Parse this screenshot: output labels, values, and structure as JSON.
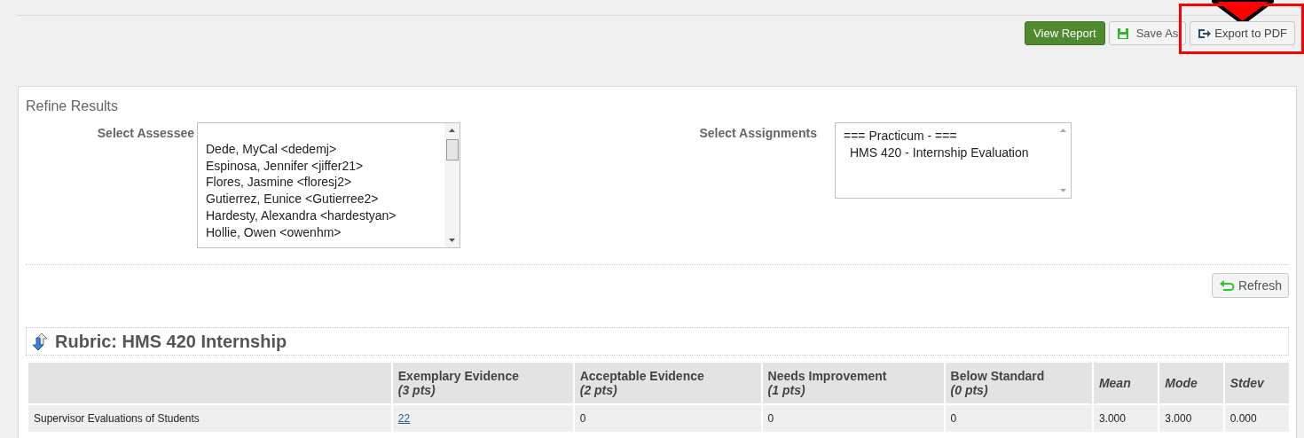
{
  "toolbar": {
    "buttons": [
      {
        "kind": "primary",
        "label": "View Report"
      },
      {
        "kind": "save",
        "label": "Save As"
      },
      {
        "kind": "export",
        "label": "Export to PDF",
        "highlighted": true
      }
    ]
  },
  "refine": {
    "title": "Refine Results",
    "assessee": {
      "label": "Select Assessee",
      "options": [
        "Dede, MyCal <dedemj>",
        "Espinosa, Jennifer <jiffer21>",
        "Flores, Jasmine <floresj2>",
        "Gutierrez, Eunice <Gutierree2>",
        "Hardesty, Alexandra <hardestyan>",
        "Hollie, Owen <owenhm>"
      ]
    },
    "assignments": {
      "label": "Select Assignments",
      "options": [
        {
          "label": "=== Practicum - ===",
          "kind": "group"
        },
        {
          "label": "HMS 420 - Internship Evaluation",
          "kind": "item"
        }
      ]
    },
    "refresh": "Refresh"
  },
  "rubric": {
    "title": "Rubric: HMS 420 Internship",
    "columns": [
      {},
      {
        "label": "Exemplary Evidence",
        "sub": "(3 pts)"
      },
      {
        "label": "Acceptable Evidence",
        "sub": "(2 pts)"
      },
      {
        "label": "Needs Improvement",
        "sub": "(1 pts)"
      },
      {
        "label": "Below Standard",
        "sub": "(0 pts)"
      },
      {
        "label": "Mean"
      },
      {
        "label": "Mode"
      },
      {
        "label": "Stdev"
      }
    ],
    "rows": [
      {
        "cells": [
          {
            "text": "Supervisor Evaluations of Students",
            "link": false
          },
          {
            "text": "22",
            "link": true
          },
          {
            "text": "0",
            "link": false
          },
          {
            "text": "0",
            "link": false
          },
          {
            "text": "0",
            "link": false
          },
          {
            "text": "3.000",
            "link": false
          },
          {
            "text": "3.000",
            "link": false
          },
          {
            "text": "0.000",
            "link": false
          }
        ]
      }
    ]
  }
}
